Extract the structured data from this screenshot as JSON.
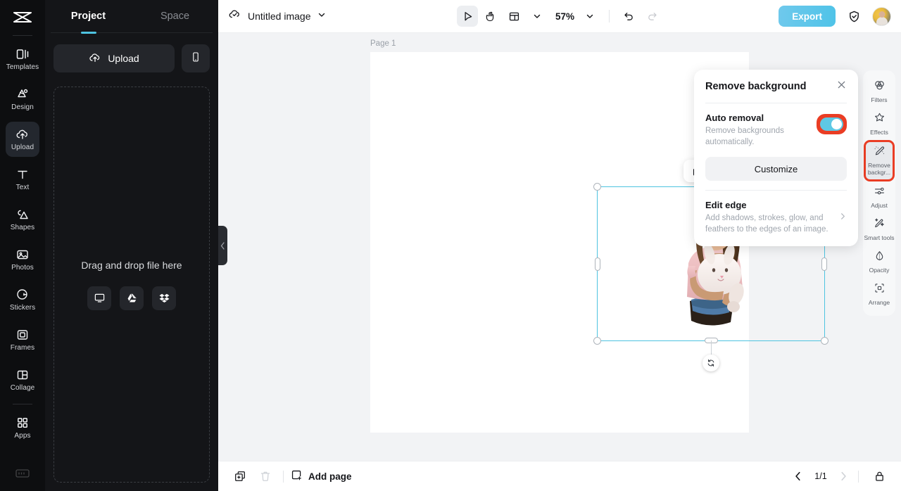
{
  "left_rail": {
    "logo": "app-logo",
    "items": [
      {
        "label": "Templates",
        "icon": "templates-icon",
        "active": false
      },
      {
        "label": "Design",
        "icon": "design-icon",
        "active": false
      },
      {
        "label": "Upload",
        "icon": "upload-cloud-icon",
        "active": true
      },
      {
        "label": "Text",
        "icon": "text-icon",
        "active": false
      },
      {
        "label": "Shapes",
        "icon": "shapes-icon",
        "active": false
      },
      {
        "label": "Photos",
        "icon": "photos-icon",
        "active": false
      },
      {
        "label": "Stickers",
        "icon": "stickers-icon",
        "active": false
      },
      {
        "label": "Frames",
        "icon": "frames-icon",
        "active": false
      },
      {
        "label": "Collage",
        "icon": "collage-icon",
        "active": false
      },
      {
        "label": "Apps",
        "icon": "apps-grid-icon",
        "active": false
      }
    ]
  },
  "panel": {
    "tabs": [
      {
        "label": "Project",
        "active": true
      },
      {
        "label": "Space",
        "active": false
      }
    ],
    "upload_label": "Upload",
    "mobile_label": "mobile-upload",
    "dropzone_text": "Drag and drop file here",
    "dropzone_sources": [
      {
        "name": "computer-icon"
      },
      {
        "name": "google-drive-icon"
      },
      {
        "name": "dropbox-icon"
      }
    ]
  },
  "topbar": {
    "doc_title": "Untitled image",
    "tools": [
      {
        "name": "select-tool",
        "active": true
      },
      {
        "name": "hand-tool",
        "active": false
      },
      {
        "name": "layout-tool",
        "active": false
      }
    ],
    "zoom": "57%",
    "undo": "undo",
    "redo": "redo",
    "export_label": "Export",
    "shield_label": "shield-check",
    "avatar_label": "user-avatar"
  },
  "canvas": {
    "page_label": "Page 1",
    "selection": {
      "float_toolbar": [
        {
          "name": "duplicate-icon"
        },
        {
          "name": "more-options-icon"
        }
      ],
      "rotate": "rotate-handle"
    }
  },
  "remove_bg_panel": {
    "title": "Remove background",
    "close": "close",
    "auto_removal": {
      "title": "Auto removal",
      "description": "Remove backgrounds automatically.",
      "enabled": true
    },
    "customize_label": "Customize",
    "edit_edge": {
      "title": "Edit edge",
      "description": "Add shadows, strokes, glow, and feathers to the edges of an image."
    }
  },
  "right_rail": {
    "items": [
      {
        "label": "Filters",
        "icon": "filters-icon",
        "active": false,
        "highlight": false
      },
      {
        "label": "Effects",
        "icon": "effects-icon",
        "active": false,
        "highlight": false
      },
      {
        "label": "Remove\nbackgr...",
        "icon": "remove-bg-icon",
        "active": true,
        "highlight": true
      },
      {
        "label": "Adjust",
        "icon": "adjust-icon",
        "active": false,
        "highlight": false
      },
      {
        "label": "Smart\ntools",
        "icon": "smart-tools-icon",
        "active": false,
        "highlight": false
      },
      {
        "label": "Opacity",
        "icon": "opacity-icon",
        "active": false,
        "highlight": false
      },
      {
        "label": "Arrange",
        "icon": "arrange-icon",
        "active": false,
        "highlight": false
      }
    ]
  },
  "bottombar": {
    "duplicate_page": "duplicate-page",
    "delete_page": "delete-page",
    "add_page_label": "Add page",
    "page_indicator": "1/1",
    "prev": "previous-page",
    "next": "next-page",
    "present": "present"
  },
  "colors": {
    "accent": "#4ec3e0",
    "highlight": "#ea3d24",
    "rail_bg": "#0d0e10",
    "panel_bg": "#141518",
    "workspace": "#f2f3f5"
  }
}
